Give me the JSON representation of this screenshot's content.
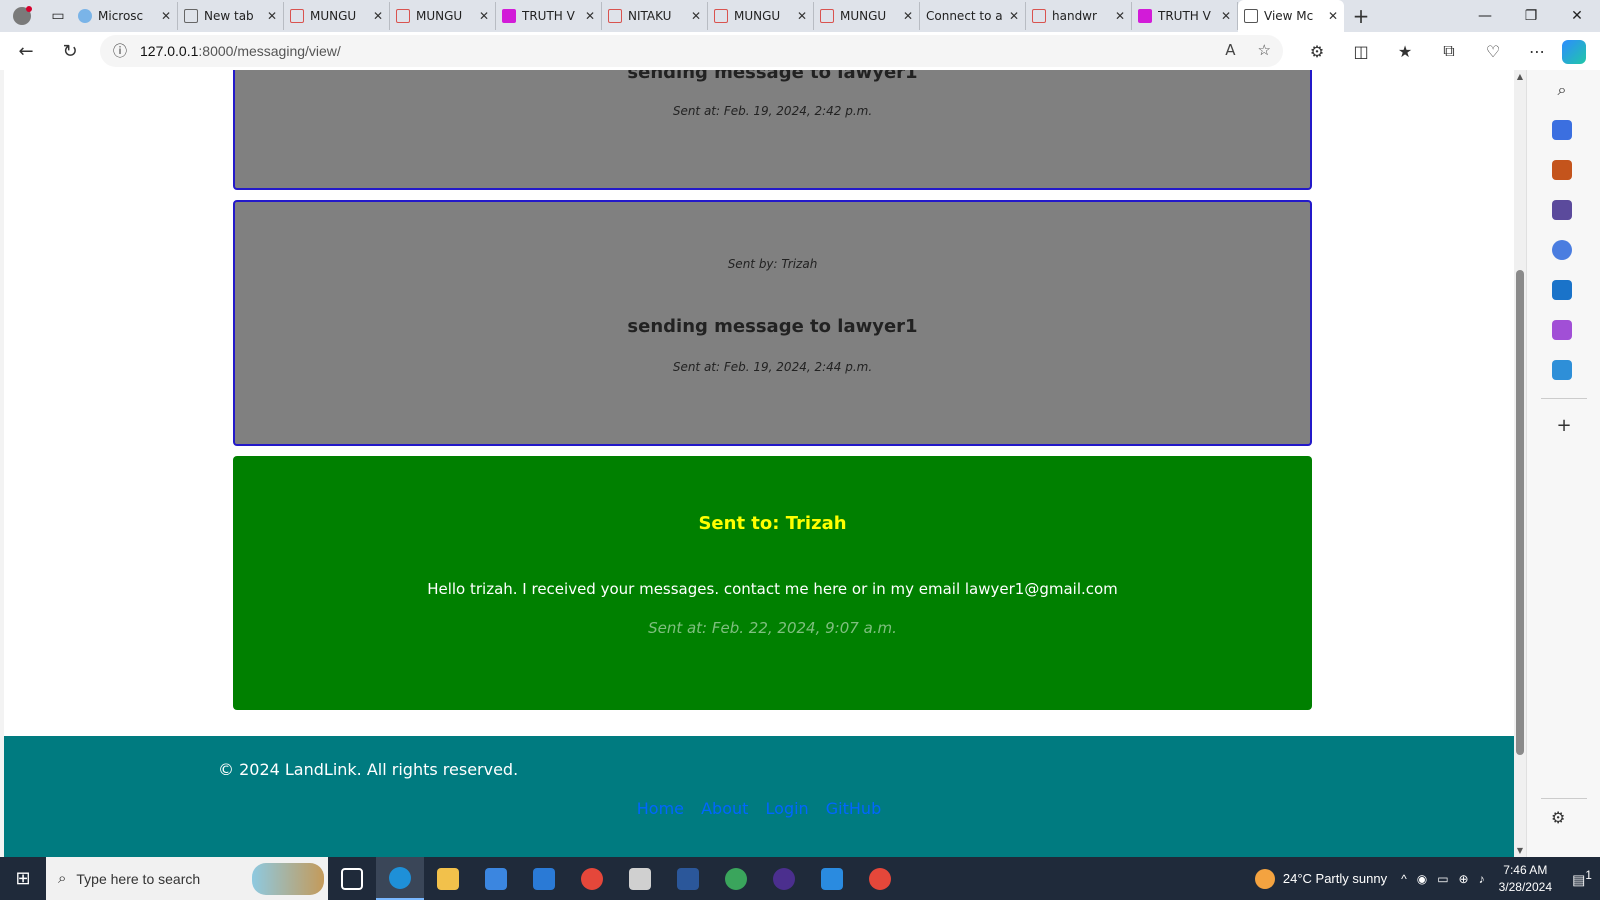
{
  "browser": {
    "tabs": [
      {
        "label": "Microsc",
        "favicon": "edge-favicon",
        "color": "#7ab4e8"
      },
      {
        "label": "New tab",
        "favicon": "newtab-favicon",
        "color": "#9aa0a6"
      },
      {
        "label": "MUNGU",
        "favicon": "pdf-favicon",
        "color": "#d9534f"
      },
      {
        "label": "MUNGU",
        "favicon": "pdf-favicon",
        "color": "#d9534f"
      },
      {
        "label": "TRUTH V",
        "favicon": "magenta-favicon",
        "color": "#d21bd8"
      },
      {
        "label": "NITAKU",
        "favicon": "pdf-favicon",
        "color": "#d9534f"
      },
      {
        "label": "MUNGU",
        "favicon": "pdf-favicon",
        "color": "#d9534f"
      },
      {
        "label": "MUNGU",
        "favicon": "pdf-favicon",
        "color": "#d9534f"
      },
      {
        "label": "Connect to a",
        "favicon": "none",
        "color": "#dfe3ea"
      },
      {
        "label": "handwr",
        "favicon": "pdf-favicon",
        "color": "#d9534f"
      },
      {
        "label": "TRUTH V",
        "favicon": "magenta-favicon",
        "color": "#d21bd8"
      },
      {
        "label": "View Mc",
        "favicon": "page-favicon",
        "color": "#ffffff"
      }
    ],
    "url_host": "127.0.0.1",
    "url_path": ":8000/messaging/view/"
  },
  "messages": [
    {
      "sent_by": "",
      "title": "sending message to lawyer1",
      "sent_at": "Sent at: Feb. 19, 2024, 2:42 p.m."
    },
    {
      "sent_by": "Sent by: Trizah",
      "title": "sending message to lawyer1",
      "sent_at": "Sent at: Feb. 19, 2024, 2:44 p.m."
    }
  ],
  "reply": {
    "sent_to": "Sent to: Trizah",
    "body": "Hello trizah. I received your messages. contact me here or in my email lawyer1@gmail.com",
    "sent_at": "Sent at: Feb. 22, 2024, 9:07 a.m."
  },
  "footer": {
    "copyright": "© 2024 LandLink. All rights reserved.",
    "links": [
      "Home",
      "About",
      "Login",
      "GitHub"
    ]
  },
  "taskbar": {
    "search_placeholder": "Type here to search",
    "weather": "24°C  Partly sunny",
    "time": "7:46 AM",
    "date": "3/28/2024",
    "notifications": "1"
  },
  "colors": {
    "grey_card": "#808080",
    "card_border": "#2319c9",
    "green_card": "#008000",
    "footer": "#007b80",
    "sent_to": "#ffff00"
  }
}
